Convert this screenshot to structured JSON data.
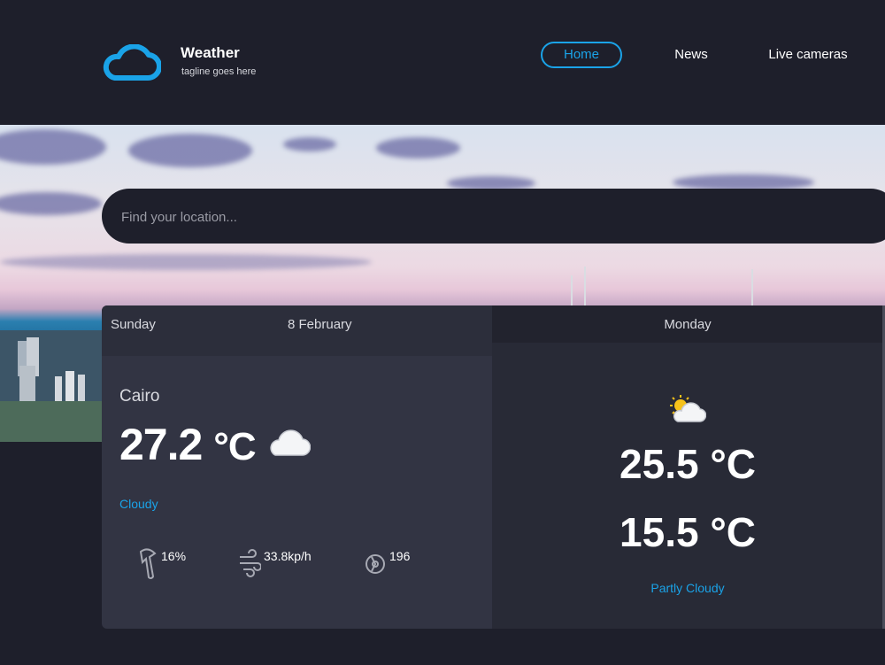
{
  "header": {
    "brand_title": "Weather",
    "brand_tagline": "tagline goes here",
    "nav": [
      {
        "label": "Home",
        "active": true
      },
      {
        "label": "News",
        "active": false
      },
      {
        "label": "Live cameras",
        "active": false
      }
    ]
  },
  "search": {
    "placeholder": "Find your location..."
  },
  "today": {
    "day": "Sunday",
    "date": "8 February",
    "city": "Cairo",
    "temperature": "27.2",
    "unit": "°C",
    "condition": "Cloudy",
    "weather_icon": "cloud-icon",
    "humidity": "16%",
    "wind": "33.8kp/h",
    "wind_direction": "196"
  },
  "tomorrow": {
    "day": "Monday",
    "max": "25.5 °C",
    "min": "15.5 °C",
    "condition": "Partly Cloudy",
    "weather_icon": "partly-cloudy-icon"
  },
  "colors": {
    "accent": "#1aa3e8",
    "background": "#1e1f2b",
    "card": "#323443"
  }
}
